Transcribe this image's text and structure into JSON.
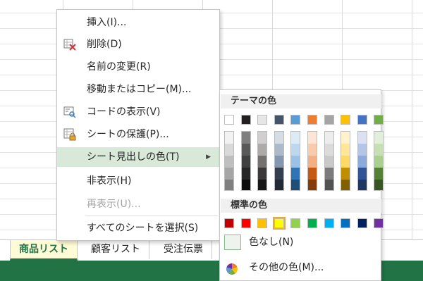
{
  "sheet_tabs": [
    "商品リスト",
    "顧客リスト",
    "受注伝票"
  ],
  "context_menu": {
    "items": [
      {
        "label": "挿入(I)...",
        "icon": "",
        "state": "normal"
      },
      {
        "label": "削除(D)",
        "icon": "delete-sheet-icon",
        "state": "normal"
      },
      {
        "label": "名前の変更(R)",
        "icon": "",
        "state": "normal"
      },
      {
        "label": "移動またはコピー(M)...",
        "icon": "",
        "state": "normal"
      },
      {
        "label": "コードの表示(V)",
        "icon": "view-code-icon",
        "state": "normal"
      },
      {
        "label": "シートの保護(P)...",
        "icon": "protect-sheet-icon",
        "state": "normal"
      },
      {
        "label": "シート見出しの色(T)",
        "icon": "",
        "state": "highlighted",
        "submenu_arrow": "▶"
      },
      {
        "label": "非表示(H)",
        "icon": "",
        "state": "normal"
      },
      {
        "label": "再表示(U)...",
        "icon": "",
        "state": "disabled"
      },
      {
        "label": "すべてのシートを選択(S)",
        "icon": "",
        "state": "normal"
      }
    ]
  },
  "color_submenu": {
    "theme_header": "テーマの色",
    "theme_colors": [
      {
        "top": "#ffffff",
        "shades": [
          "#f2f2f2",
          "#d9d9d9",
          "#bfbfbf",
          "#a6a6a6",
          "#808080"
        ]
      },
      {
        "top": "#231f20",
        "shades": [
          "#7f7f7f",
          "#595959",
          "#404040",
          "#262626",
          "#0d0d0d"
        ]
      },
      {
        "top": "#e7e6e6",
        "shades": [
          "#d0cece",
          "#aeaaaa",
          "#757171",
          "#3a3838",
          "#161616"
        ]
      },
      {
        "top": "#44546a",
        "shades": [
          "#d6dce4",
          "#adb9ca",
          "#8497b0",
          "#333f4f",
          "#222a35"
        ]
      },
      {
        "top": "#5b9bd5",
        "shades": [
          "#ddebf7",
          "#bdd7ee",
          "#9bc2e6",
          "#2f75b5",
          "#1f4e78"
        ]
      },
      {
        "top": "#ed7d31",
        "shades": [
          "#fce4d6",
          "#f8cbad",
          "#f4b084",
          "#c65911",
          "#833c0b"
        ]
      },
      {
        "top": "#a5a5a5",
        "shades": [
          "#ededed",
          "#dbdbdb",
          "#c9c9c9",
          "#7b7b7b",
          "#525252"
        ]
      },
      {
        "top": "#ffc000",
        "shades": [
          "#fff2cc",
          "#ffe699",
          "#ffd966",
          "#bf8f00",
          "#806000"
        ]
      },
      {
        "top": "#4472c4",
        "shades": [
          "#d9e1f2",
          "#b4c6e7",
          "#8ea9db",
          "#305496",
          "#203764"
        ]
      },
      {
        "top": "#70ad47",
        "shades": [
          "#e2efda",
          "#c6e0b4",
          "#a9d08e",
          "#548235",
          "#375623"
        ]
      }
    ],
    "standard_header": "標準の色",
    "standard_colors": [
      "#c00000",
      "#ff0000",
      "#ffc000",
      "#ffff00",
      "#92d050",
      "#00b050",
      "#00b0f0",
      "#0070c0",
      "#002060",
      "#7030a0"
    ],
    "selected_standard_index": 3,
    "no_color_label": "色なし(N)",
    "more_colors_label": "その他の色(M)...",
    "more_colors_icon": "color-wheel-icon"
  },
  "colors": {
    "excel_green": "#217346",
    "highlight": "#d9e9d9"
  }
}
